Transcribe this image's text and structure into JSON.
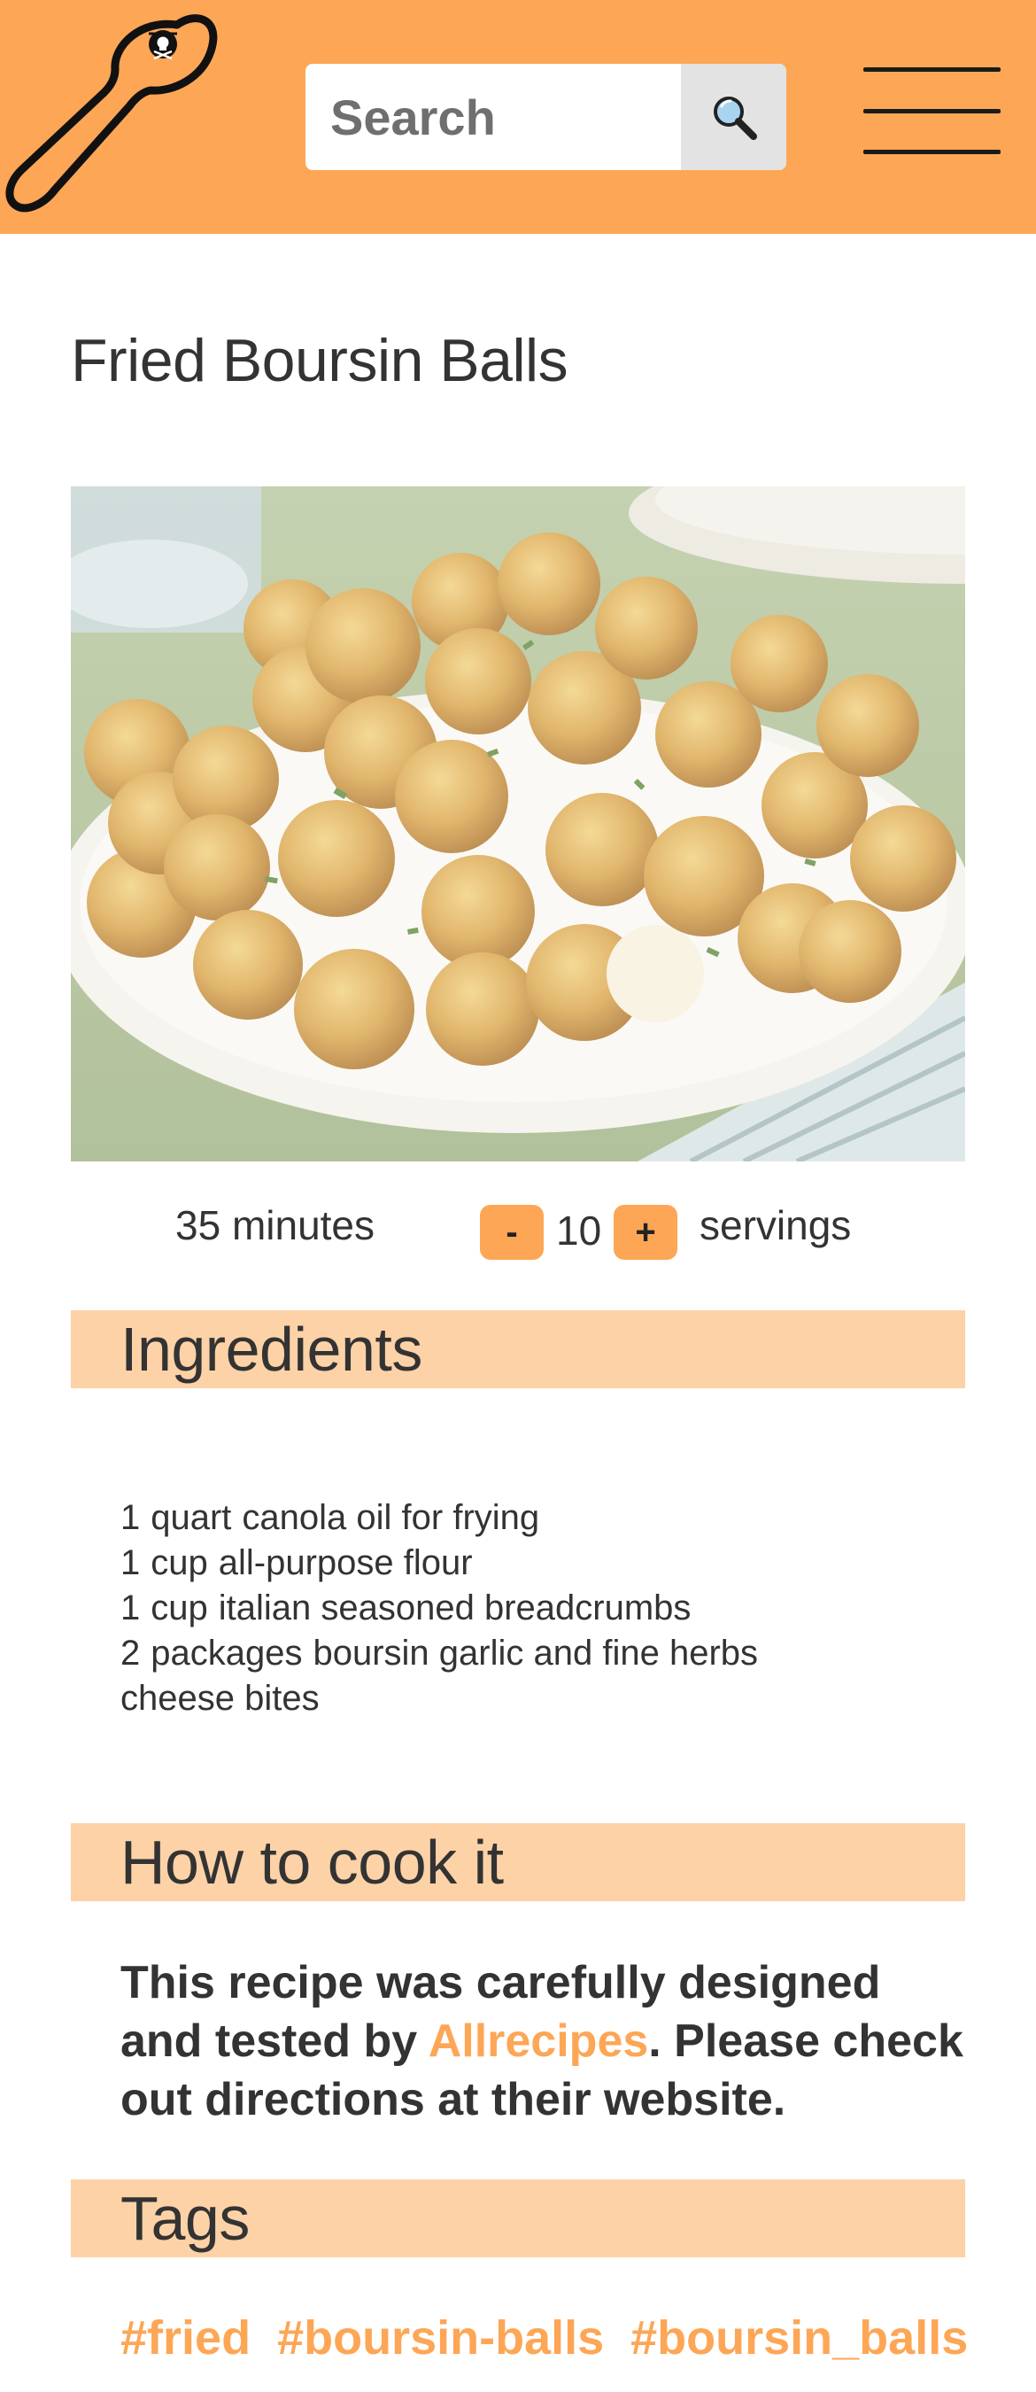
{
  "header": {
    "search": {
      "placeholder": "Search",
      "value": ""
    },
    "colors": {
      "brand": "#fda656",
      "section_bg": "#fdd2a7"
    }
  },
  "recipe": {
    "title": "Fried Boursin Balls",
    "time": "35 minutes",
    "servings": {
      "count": "10",
      "minus": "-",
      "plus": "+",
      "label": "servings"
    }
  },
  "sections": {
    "ingredients": "Ingredients",
    "cook": "How to cook it",
    "tags": "Tags"
  },
  "ingredients": [
    {
      "qty": "1",
      "unit": "quart",
      "name": "canola oil for frying"
    },
    {
      "qty": "1",
      "unit": "cup",
      "name": "all-purpose flour"
    },
    {
      "qty": "1",
      "unit": "cup",
      "name": "italian seasoned breadcrumbs"
    },
    {
      "qty": "2",
      "unit": "packages",
      "name": "boursin garlic and fine herbs cheese bites"
    }
  ],
  "cook": {
    "before": "This recipe was carefully designed and tested by ",
    "link": "Allrecipes",
    "after": ". Please check out directions at their website."
  },
  "tags": [
    "#fried",
    "#boursin-balls",
    "#boursin_balls"
  ]
}
